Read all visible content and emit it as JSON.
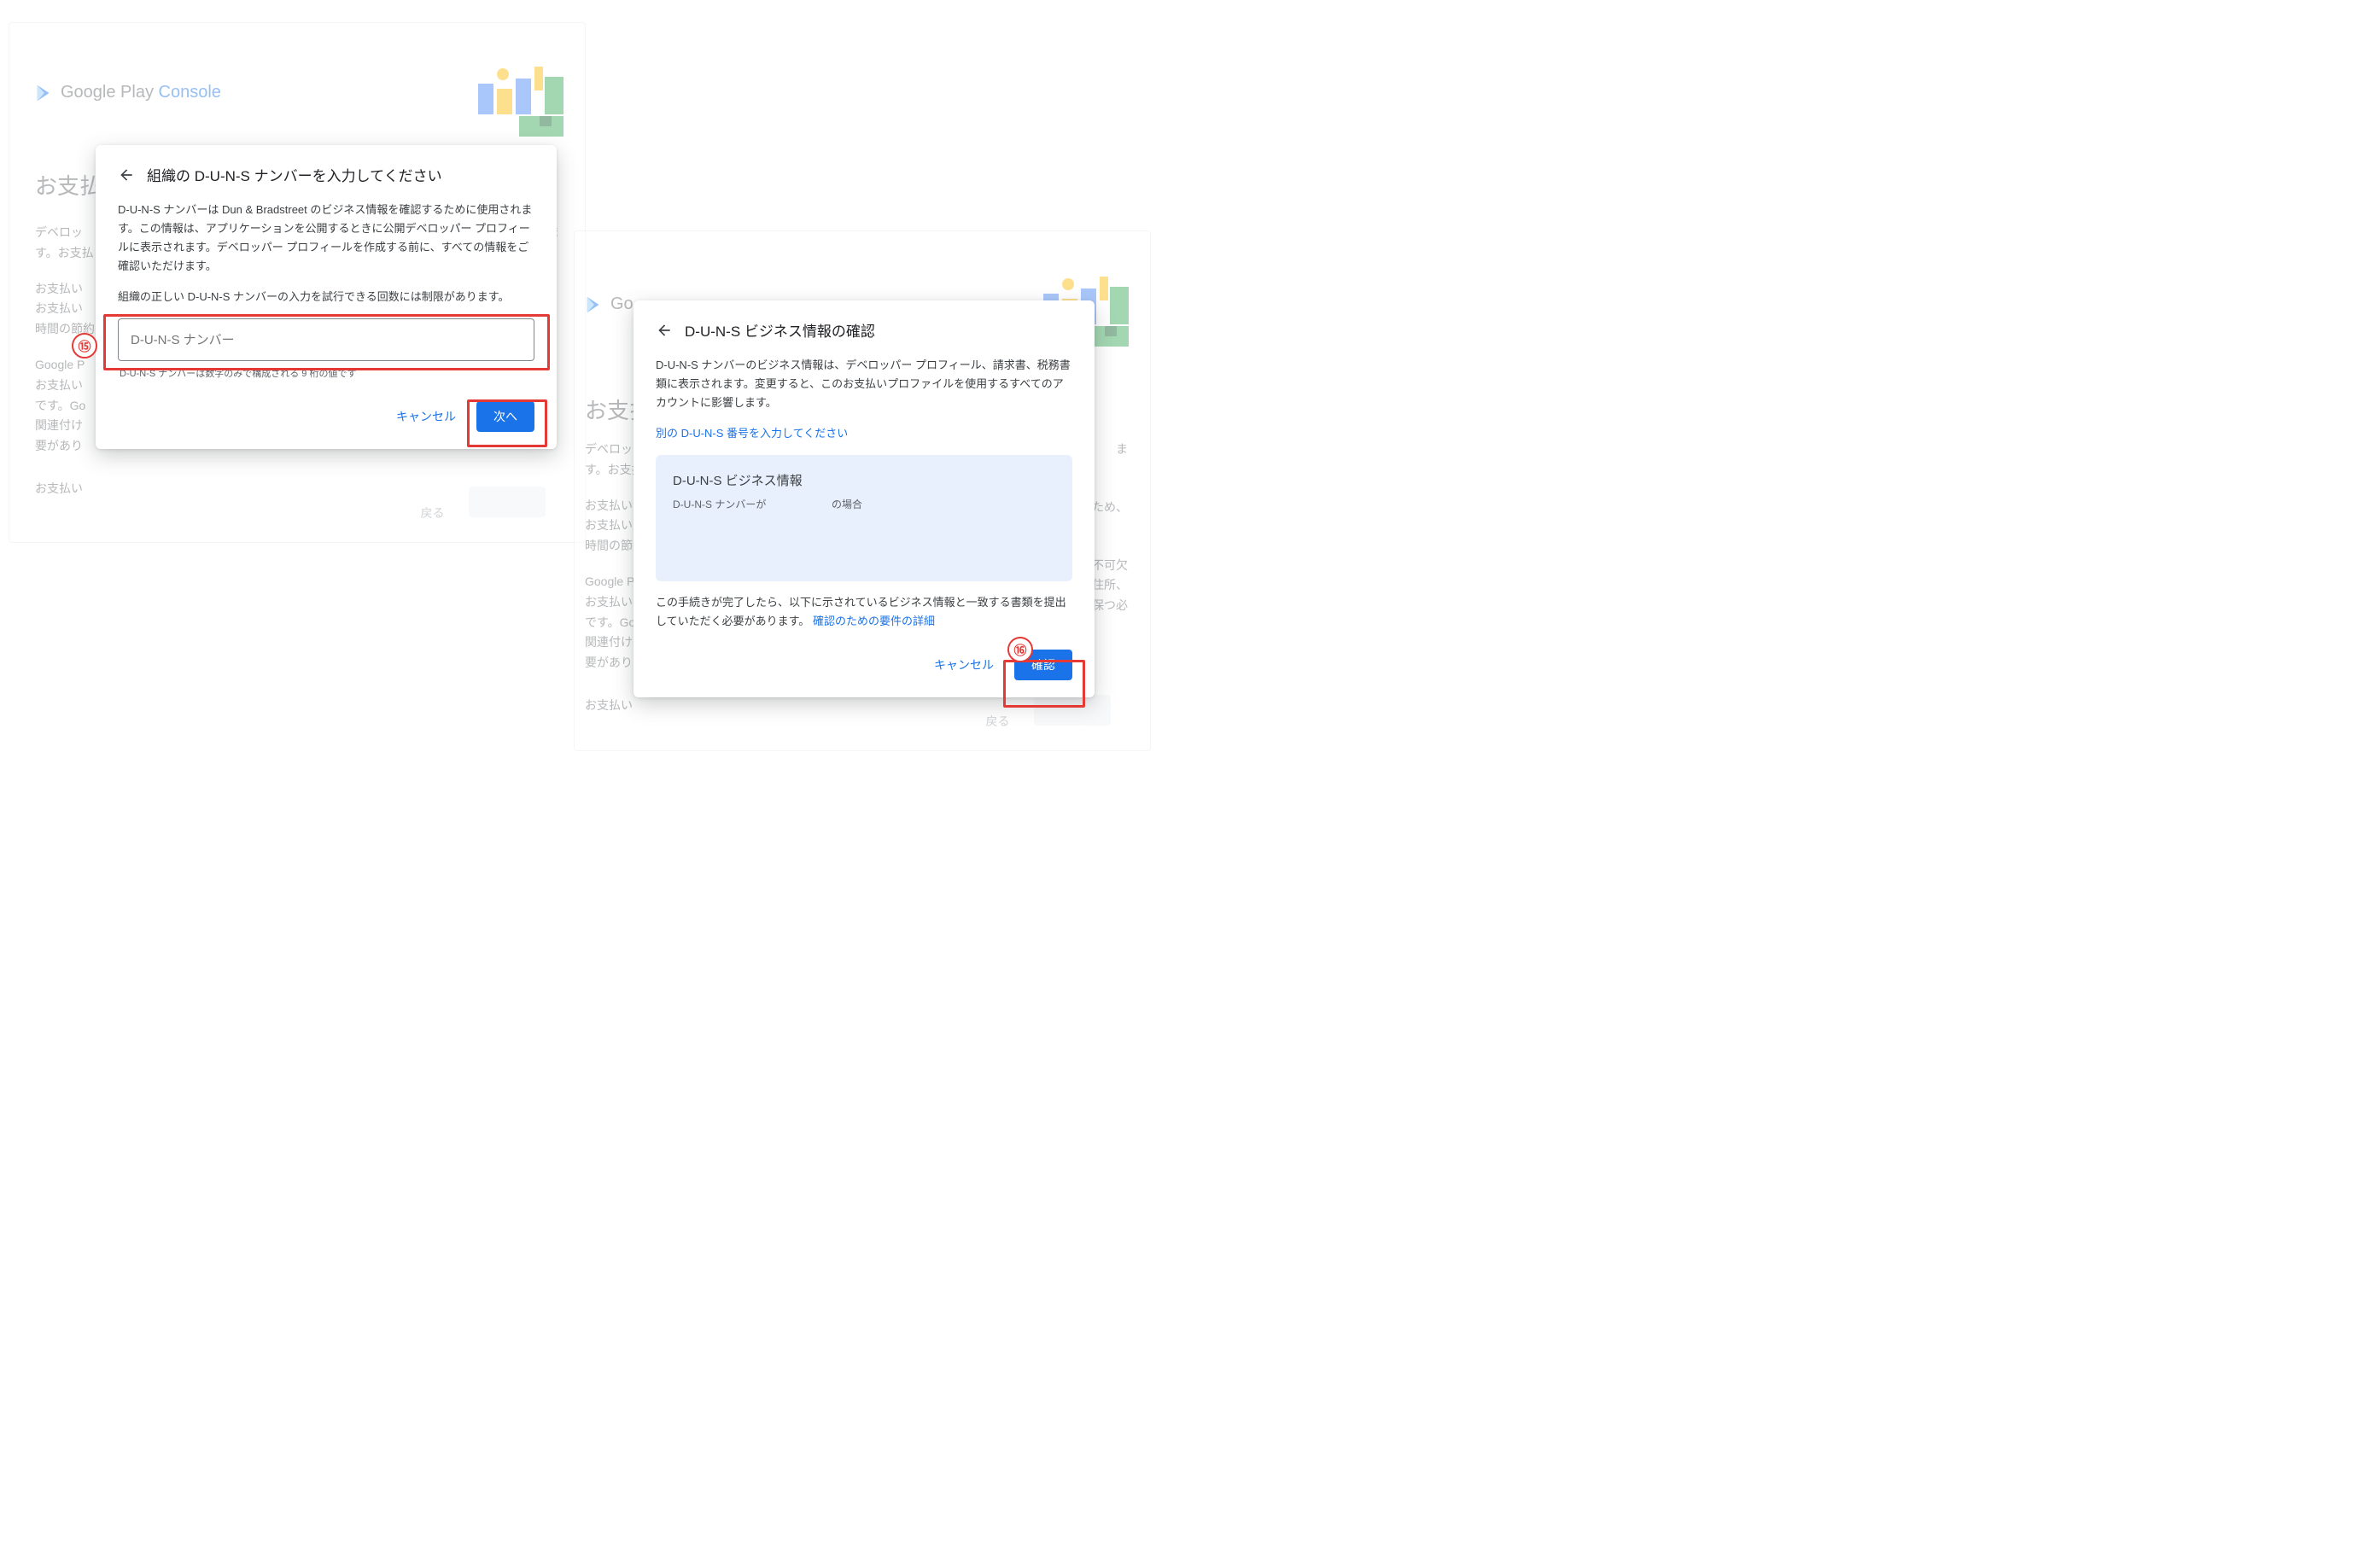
{
  "brand": {
    "name_grey": "Google Play",
    "name_blue": "Console"
  },
  "left_bg": {
    "heading": "お支払",
    "line1_a": "デベロッ",
    "line1_b": "ま",
    "line2": "す。お支払",
    "line3": "お支払い",
    "line4": "お支払い",
    "line5": "時間の節約",
    "line6": "Google P",
    "line7": "お支払い",
    "line8_a": "です。Go",
    "line9": "関連付け",
    "line10": "要があり",
    "line11": "お支払い",
    "back_btn": "戻る"
  },
  "right_bg": {
    "brand_fragment": "Go",
    "heading": "お支払",
    "line1_a": "デベロッ",
    "line1_b": "ま",
    "line2": "す。お支払",
    "line3": "お支払い",
    "line4_a": "お支払い",
    "line4_b": "ため、",
    "line5": "時間の節約",
    "line6": "Google P",
    "line7_a": "お支払い",
    "line7_b": "不可欠",
    "line8_a": "です。Go",
    "line8_b": "住所、",
    "line9_a": "関連付け",
    "line9_b": "保つ必",
    "line10": "要があり",
    "line11": "お支払い",
    "back_btn": "戻る"
  },
  "modal1": {
    "title": "組織の D-U-N-S ナンバーを入力してください",
    "p1": "D-U-N-S ナンバーは Dun & Bradstreet のビジネス情報を確認するために使用されます。この情報は、アプリケーションを公開するときに公開デベロッパー プロフィールに表示されます。デベロッパー プロフィールを作成する前に、すべての情報をご確認いただけます。",
    "p2": "組織の正しい D-U-N-S ナンバーの入力を試行できる回数には制限があります。",
    "input_placeholder": "D-U-N-S ナンバー",
    "helper": "D-U-N-S ナンバーは数字のみで構成される 9 桁の値です",
    "cancel": "キャンセル",
    "next": "次へ"
  },
  "modal2": {
    "title": "D-U-N-S ビジネス情報の確認",
    "p1": "D-U-N-S ナンバーのビジネス情報は、デベロッパー プロフィール、請求書、税務書類に表示されます。変更すると、このお支払いプロファイルを使用するすべてのアカウントに影響します。",
    "link_other": "別の D-U-N-S 番号を入力してください",
    "card_title": "D-U-N-S ビジネス情報",
    "card_sub1": "D-U-N-S ナンバーが",
    "card_sub2": "の場合",
    "p2a": "この手続きが完了したら、以下に示されているビジネス情報と一致する書類を提出していただく必要があります。",
    "p2_link": "確認のための要件の詳細",
    "cancel": "キャンセル",
    "confirm": "確認"
  },
  "annotations": {
    "n15": "⑮",
    "n16": "⑯"
  }
}
